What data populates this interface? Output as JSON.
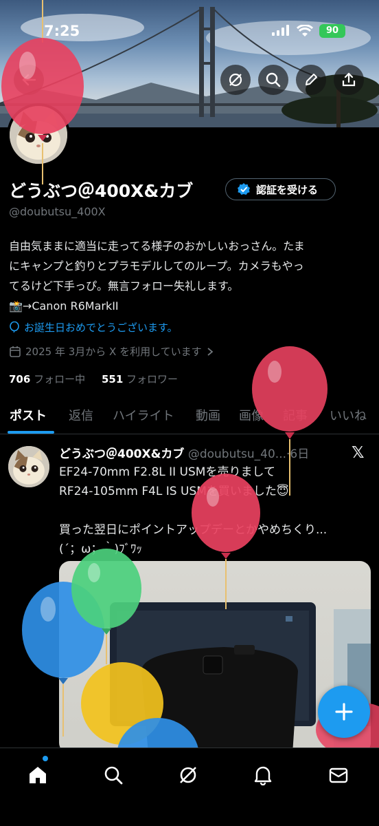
{
  "status_bar": {
    "time": "7:25",
    "battery": "90"
  },
  "header_actions": [
    "grok-icon",
    "search-icon",
    "edit-icon",
    "share-icon"
  ],
  "profile": {
    "display_name": "どうぶつ＠400X&カブ",
    "verify_label": "認証を受ける",
    "handle": "@doubutsu_400X",
    "bio_lines": [
      "自由気ままに適当に走ってる様子のおかしいおっさん。たま",
      "にキャンプと釣りとプラモデルしてのループ。カメラもやっ",
      "てるけど下手っぴ。無言フォロー失礼します。",
      "📸→Canon R6MarkII"
    ],
    "birthday": "お誕生日おめでとうございます。",
    "joined": "2025 年 3月から X を利用しています",
    "following_count": "706",
    "following_label": "フォロー中",
    "followers_count": "551",
    "followers_label": "フォロワー"
  },
  "tabs": [
    {
      "label": "ポスト",
      "active": true
    },
    {
      "label": "返信"
    },
    {
      "label": "ハイライト"
    },
    {
      "label": "動画"
    },
    {
      "label": "画像"
    },
    {
      "label": "記事"
    },
    {
      "label": "いいね"
    }
  ],
  "post": {
    "author_name": "どうぶつ＠400X&カブ",
    "author_handle": "@doubutsu_40...",
    "time": "6日",
    "text_lines": [
      "EF24-70mm F2.8L II USMを売りまして",
      "RF24-105mm F4L IS USMを買いました😇",
      "",
      "買った翌日にポイントアップデーとかやめちくり...",
      "(´；ω；｀)ﾌﾞﾜｯ"
    ]
  },
  "colors": {
    "accent": "#1d9bf0",
    "background": "#000000",
    "secondary_text": "#71767b"
  }
}
